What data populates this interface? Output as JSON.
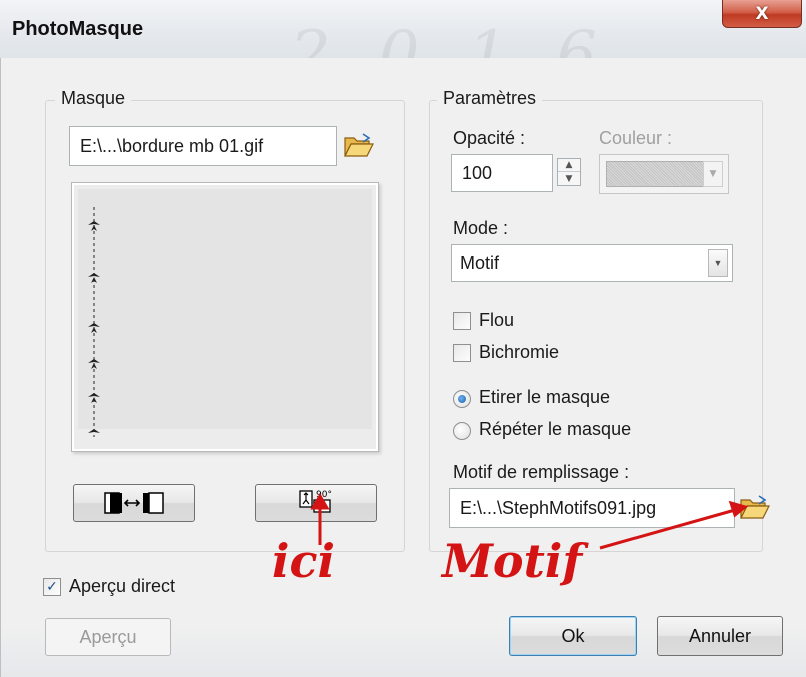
{
  "window": {
    "title": "PhotoMasque",
    "close_glyph": "X"
  },
  "masque_group": {
    "title": "Masque",
    "file_path": "E:\\...\\bordure mb 01.gif",
    "browse_icon": "folder-open-icon",
    "invert_icon": "invert-mask-icon",
    "rotate_icon": "rotate-90-icon",
    "rotate_caption": "90°"
  },
  "params_group": {
    "title": "Paramètres",
    "opacity_label": "Opacité :",
    "opacity_value": "100",
    "color_label": "Couleur :",
    "mode_label": "Mode :",
    "mode_value": "Motif",
    "flou_label": "Flou",
    "flou_checked": false,
    "bichromie_label": "Bichromie",
    "bichromie_checked": false,
    "stretch_label": "Etirer le masque",
    "stretch_selected": true,
    "repeat_label": "Répéter le masque",
    "repeat_selected": false,
    "pattern_label": "Motif de remplissage :",
    "pattern_path": "E:\\...\\StephMotifs091.jpg",
    "pattern_browse_icon": "folder-open-icon"
  },
  "footer": {
    "live_preview_label": "Aperçu direct",
    "live_preview_checked": true,
    "preview_button": "Aperçu",
    "ok_button": "Ok",
    "cancel_button": "Annuler"
  },
  "annotations": {
    "ici": "ici",
    "motif": "Motif",
    "color": "#d41414"
  }
}
